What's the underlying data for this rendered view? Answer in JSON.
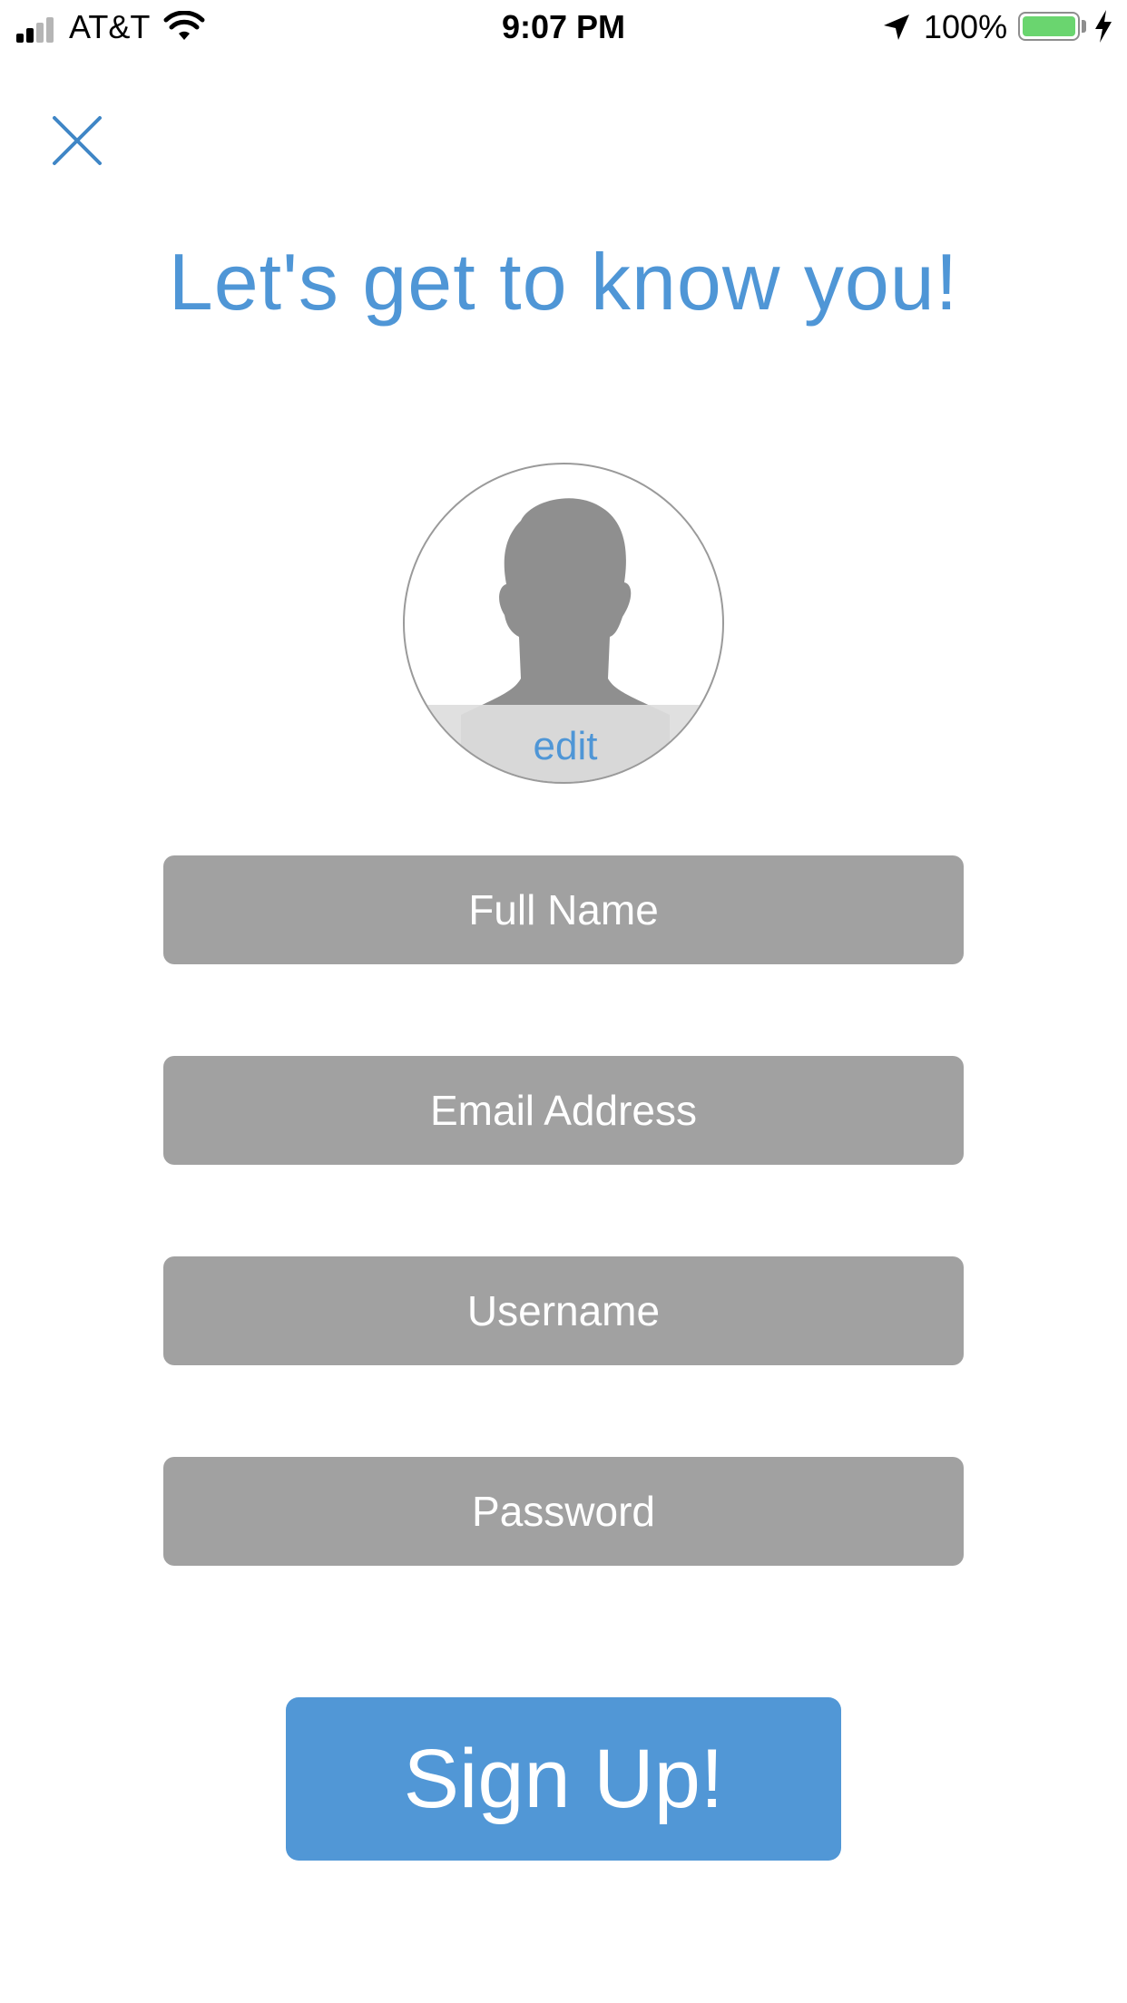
{
  "status_bar": {
    "carrier": "AT&T",
    "time": "9:07 PM",
    "battery_percent_label": "100%",
    "battery_level": 1.0,
    "signal_bars_filled": 2,
    "signal_bars_total": 4,
    "icons": [
      "signal-icon",
      "wifi-icon",
      "location-arrow-icon",
      "battery-icon",
      "charging-bolt-icon"
    ],
    "battery_color": "#6ad56f"
  },
  "header": {
    "close_icon": "close-icon",
    "title": "Let's get to know you!"
  },
  "avatar": {
    "icon": "person-silhouette-icon",
    "edit_label": "edit"
  },
  "form": {
    "full_name": {
      "placeholder": "Full Name",
      "value": ""
    },
    "email": {
      "placeholder": "Email Address",
      "value": ""
    },
    "username": {
      "placeholder": "Username",
      "value": ""
    },
    "password": {
      "placeholder": "Password",
      "value": ""
    }
  },
  "signup_button": {
    "label": "Sign Up!"
  },
  "colors": {
    "accent": "#4f96d6",
    "button": "#5197d6",
    "field_background": "#a1a1a1",
    "field_text": "#ffffff",
    "background": "#ffffff"
  }
}
